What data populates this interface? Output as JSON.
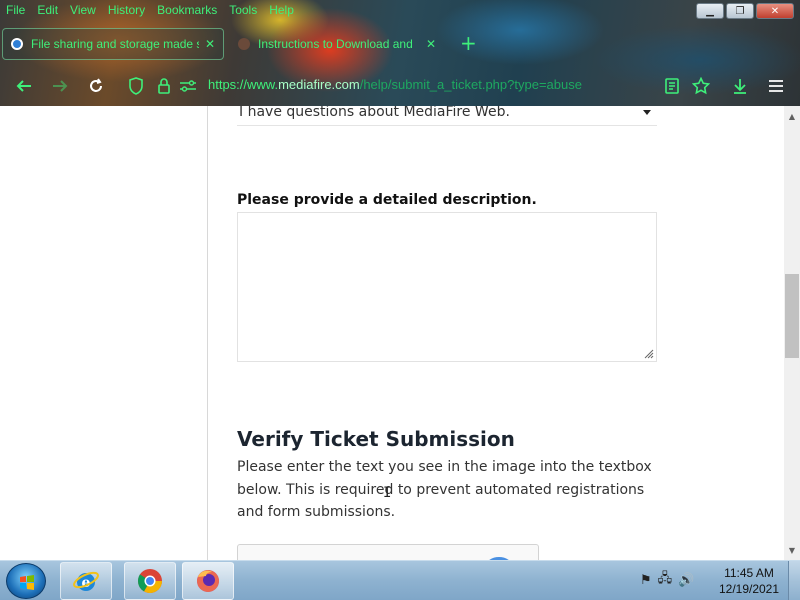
{
  "menubar": {
    "items": [
      "File",
      "Edit",
      "View",
      "History",
      "Bookmarks",
      "Tools",
      "Help"
    ]
  },
  "tabs": [
    {
      "title": "File sharing and storage made s",
      "active": true,
      "close": "✕"
    },
    {
      "title": "Instructions to Download and",
      "active": false,
      "close": "✕"
    }
  ],
  "newtab": "+",
  "address": {
    "prefix": "https://www.",
    "domain": "mediafire.com",
    "path": "/help/submit_a_ticket.php?type=abuse"
  },
  "form": {
    "select_value": "I have questions about MediaFire Web.",
    "description_label": "Please provide a detailed description.",
    "description_value": "",
    "verify_title": "Verify Ticket Submission",
    "verify_text": "Please enter the text you see in the image into the textbox below. This is required to prevent automated registrations and form submissions."
  },
  "taskbar": {
    "apps": [
      "internet-explorer",
      "chrome",
      "firefox"
    ],
    "time": "11:45 AM",
    "date": "12/19/2021"
  },
  "colors": {
    "chrome_text": "#3ef07a",
    "heading": "#1c2530"
  }
}
